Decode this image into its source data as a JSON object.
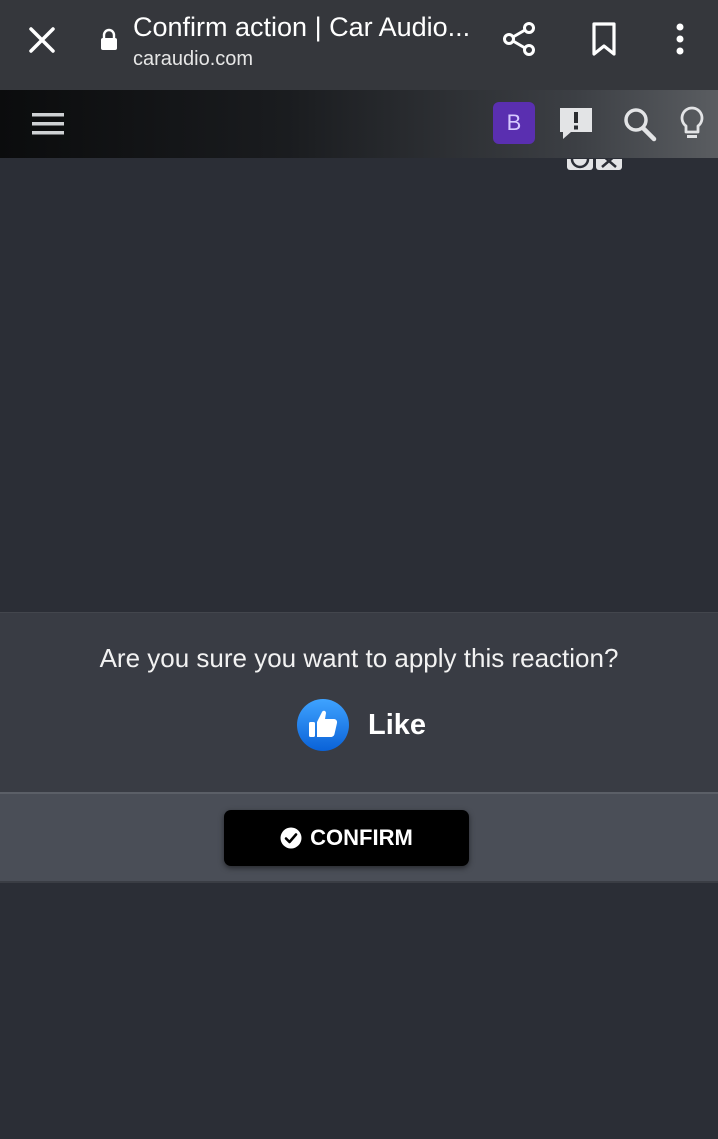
{
  "browser": {
    "title": "Confirm action | Car Audio...",
    "url": "caraudio.com",
    "icons": [
      "close-icon",
      "lock-icon",
      "share-icon",
      "bookmark-icon",
      "more-vert-icon"
    ]
  },
  "header": {
    "avatar_letter": "B",
    "avatar_color": "#5a2fb0",
    "icons": [
      "hamburger-menu-icon",
      "alert-icon",
      "search-icon",
      "lightbulb-icon"
    ]
  },
  "modal": {
    "question": "Are you sure you want to apply this reaction?",
    "reaction_label": "Like",
    "reaction_icon": "thumbs-up-icon",
    "confirm_label": "CONFIRM",
    "confirm_icon": "check-circle-icon",
    "accent_color": "#1e88e5"
  }
}
